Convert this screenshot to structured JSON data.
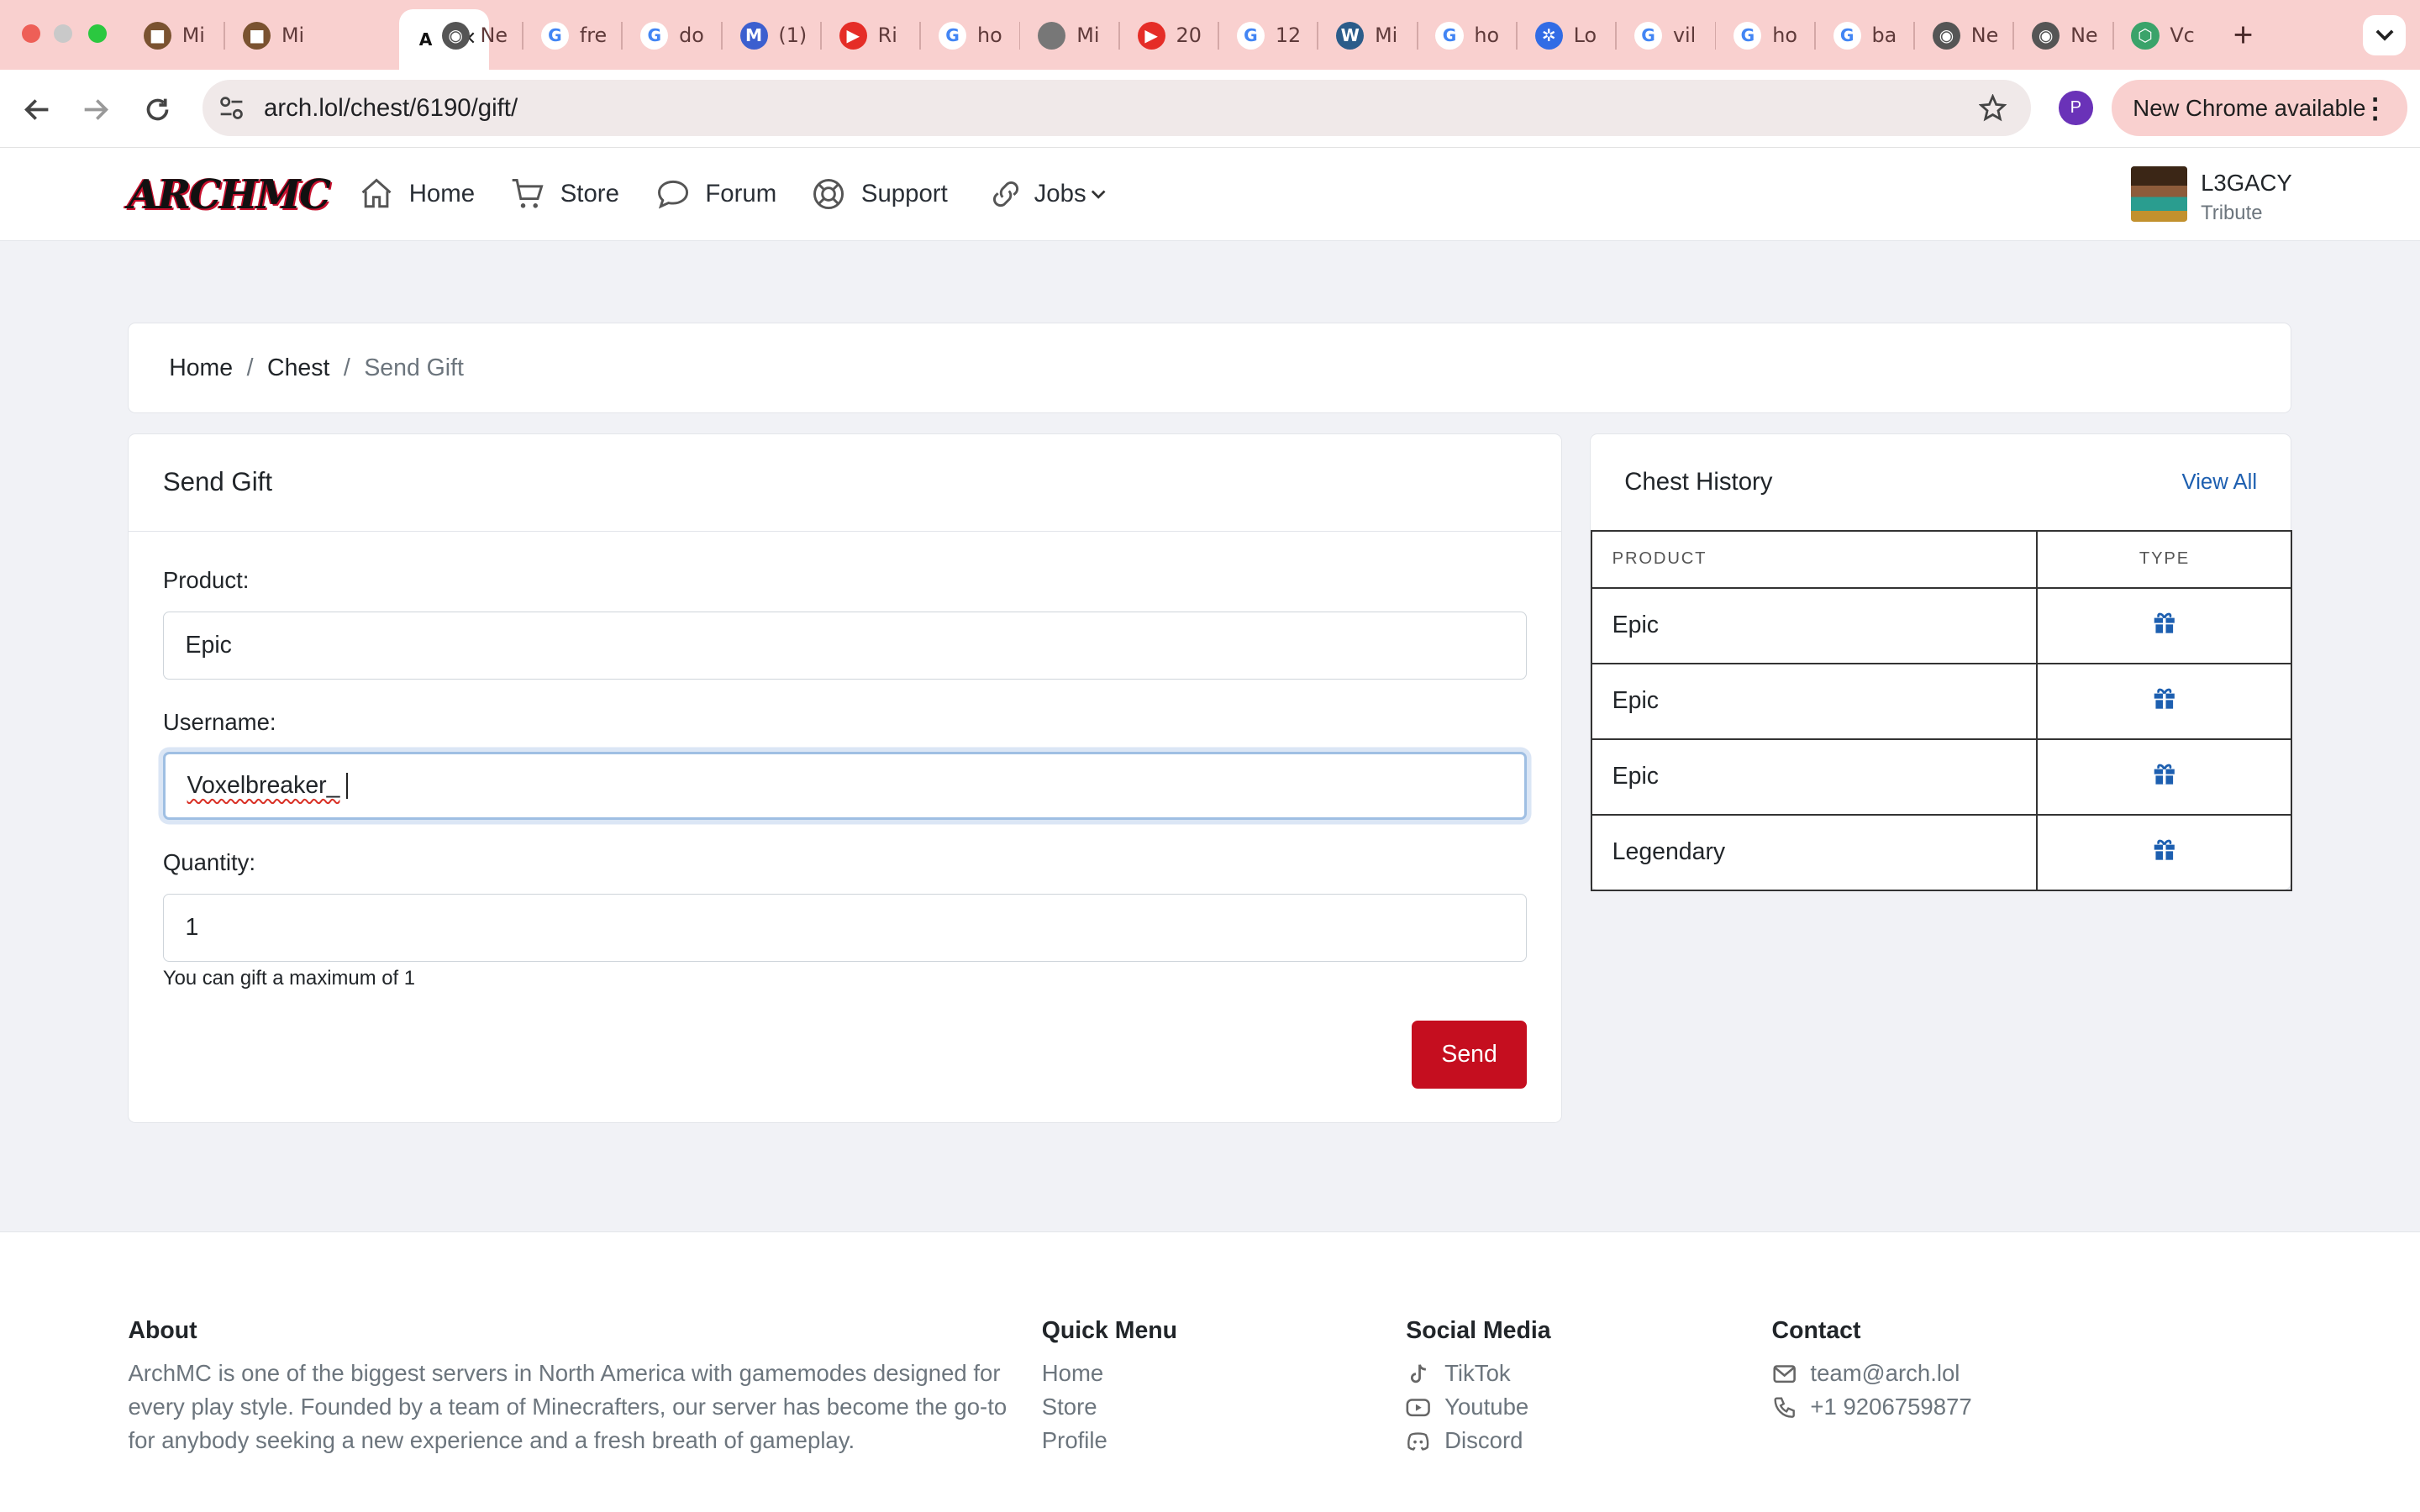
{
  "browser": {
    "tabs": [
      {
        "label": "Mi",
        "icon": "minecraft-block-icon"
      },
      {
        "label": "Mi",
        "icon": "minecraft-block-icon"
      },
      {
        "label": "",
        "icon": "archmc-icon",
        "active": true
      },
      {
        "label": "Ne",
        "icon": "chrome-icon"
      },
      {
        "label": "fre",
        "icon": "google-icon"
      },
      {
        "label": "do",
        "icon": "google-icon"
      },
      {
        "label": "(1)",
        "icon": "gmail-icon"
      },
      {
        "label": "Ri",
        "icon": "youtube-icon"
      },
      {
        "label": "ho",
        "icon": "google-icon"
      },
      {
        "label": "Mi",
        "icon": "apple-icon"
      },
      {
        "label": "20",
        "icon": "youtube-icon"
      },
      {
        "label": "12",
        "icon": "google-icon"
      },
      {
        "label": "Mi",
        "icon": "wordpress-icon"
      },
      {
        "label": "ho",
        "icon": "google-icon"
      },
      {
        "label": "Lo",
        "icon": "kubernetes-icon"
      },
      {
        "label": "vil",
        "icon": "google-icon"
      },
      {
        "label": "ho",
        "icon": "google-icon"
      },
      {
        "label": "ba",
        "icon": "google-icon"
      },
      {
        "label": "Ne",
        "icon": "chrome-icon"
      },
      {
        "label": "Ne",
        "icon": "chrome-icon"
      },
      {
        "label": "Vc",
        "icon": "cube-icon"
      }
    ],
    "url": "arch.lol/chest/6190/gift/",
    "profile_initial": "P",
    "update_label": "New Chrome available"
  },
  "nav": {
    "logo": "ARCHMC",
    "items": [
      {
        "label": "Home",
        "icon": "home-icon"
      },
      {
        "label": "Store",
        "icon": "cart-icon"
      },
      {
        "label": "Forum",
        "icon": "chat-icon"
      },
      {
        "label": "Support",
        "icon": "lifebuoy-icon"
      },
      {
        "label": "Jobs",
        "icon": "link-icon"
      }
    ],
    "user": {
      "name": "L3GACY",
      "role": "Tribute"
    }
  },
  "breadcrumb": {
    "items": [
      "Home",
      "Chest"
    ],
    "current": "Send Gift"
  },
  "gift_form": {
    "title": "Send Gift",
    "product_label": "Product:",
    "product_value": "Epic",
    "username_label": "Username:",
    "username_value": "Voxelbreaker_",
    "quantity_label": "Quantity:",
    "quantity_value": "1",
    "quantity_hint": "You can gift a maximum of 1",
    "send_label": "Send"
  },
  "history": {
    "title": "Chest History",
    "view_all": "View All",
    "columns": [
      "PRODUCT",
      "TYPE"
    ],
    "rows": [
      {
        "product": "Epic",
        "type_icon": "gift-icon"
      },
      {
        "product": "Epic",
        "type_icon": "gift-icon"
      },
      {
        "product": "Epic",
        "type_icon": "gift-icon"
      },
      {
        "product": "Legendary",
        "type_icon": "gift-icon"
      }
    ],
    "icon_color": "#1d5fb0"
  },
  "footer": {
    "about_title": "About",
    "about_text": "ArchMC is one of the biggest servers in North America with gamemodes designed for every play style. Founded by a team of Minecrafters, our server has become the go-to for anybody seeking a new experience and a fresh breath of gameplay.",
    "quick_title": "Quick Menu",
    "quick_links": [
      "Home",
      "Store",
      "Profile"
    ],
    "social_title": "Social Media",
    "social_links": [
      {
        "label": "TikTok",
        "icon": "tiktok-icon"
      },
      {
        "label": "Youtube",
        "icon": "youtube-icon"
      },
      {
        "label": "Discord",
        "icon": "discord-icon"
      }
    ],
    "contact_title": "Contact",
    "contact_email": "team@arch.lol",
    "contact_phone": "+1 9206759877"
  },
  "colors": {
    "accent": "#c50e1f",
    "link": "#1d5fb0",
    "tabstrip": "#f9d0cf"
  }
}
